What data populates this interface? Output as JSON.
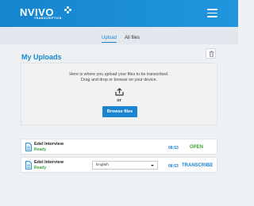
{
  "header": {
    "logo_main": "NVIVO",
    "logo_sub": "TRANSCRIPTION",
    "menu_icon": "hamburger-menu-icon"
  },
  "tabs": [
    {
      "label": "Upload",
      "active": true
    },
    {
      "label": "All files",
      "active": false
    }
  ],
  "page": {
    "title": "My Uploads",
    "delete_icon": "trash-icon"
  },
  "upload": {
    "line1": "Here is where you upload your  files to be transcribed.",
    "line2": "Drag and drop or browse on your device.",
    "icon": "upload-icon",
    "or_text": "or",
    "browse_label": "Browse files"
  },
  "files": [
    {
      "name": "Edel Interview",
      "status": "Ready",
      "time": "08:53",
      "action": "OPEN",
      "icon": "document-icon"
    },
    {
      "name": "Edel Interview",
      "status": "Ready",
      "language": "English",
      "time": "08:53",
      "action": "TRANSCRIBE",
      "icon": "document-icon"
    }
  ],
  "colors": {
    "brand_blue": "#1a84d0",
    "ready_green": "#3aa63a",
    "header_blue": "#1684cf"
  }
}
